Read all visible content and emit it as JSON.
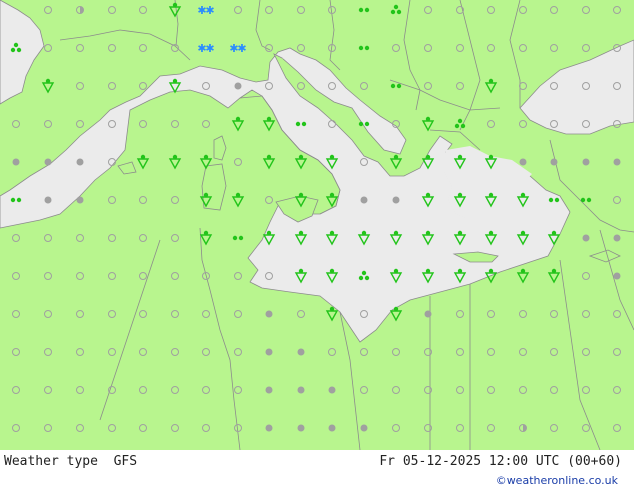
{
  "footer": {
    "left_label": "Weather type  GFS",
    "right_label": "Fr 05-12-2025 12:00 UTC (00+60)",
    "credit": "©weatheronline.co.uk"
  },
  "colors": {
    "land": "#b8f58e",
    "sea": "#ebebeb",
    "border": "#8c8c8c",
    "dot_grey": "#a0a0a0",
    "symbol_green": "#22c41a",
    "snow_blue": "#2a8cff"
  },
  "legend_symbols": [
    "no-precip-circle",
    "cloud-dot",
    "rain-shower",
    "snow-shower",
    "drizzle",
    "rain-dots"
  ]
}
